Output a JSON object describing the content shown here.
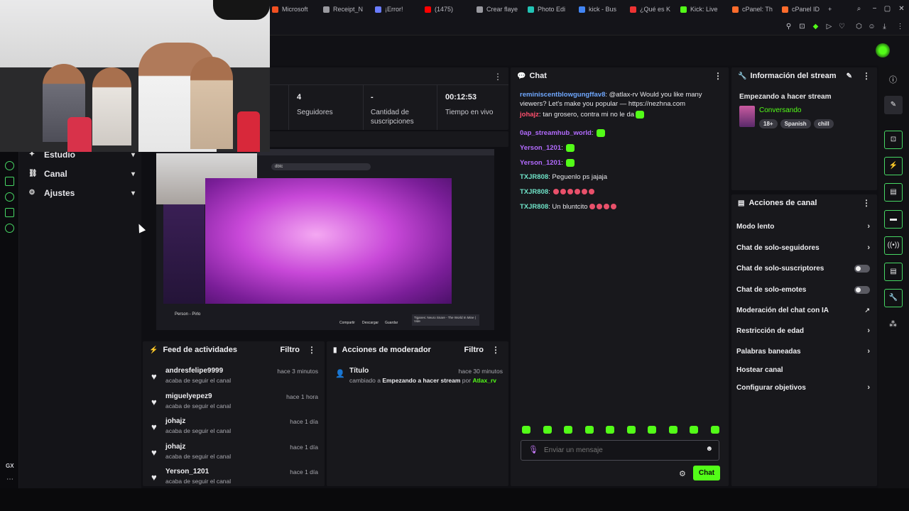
{
  "browser": {
    "tabs": [
      {
        "label": "Microsoft",
        "color": "#f25022"
      },
      {
        "label": "Receipt_N",
        "color": "#9a9aa0"
      },
      {
        "label": "¡Error!",
        "color": "#6a7cff"
      },
      {
        "label": "(1475)",
        "color": "#ff0000"
      },
      {
        "label": "Crear flaye",
        "color": "#9a9aa0"
      },
      {
        "label": "Photo Edi",
        "color": "#22c3b5"
      },
      {
        "label": "kick - Bus",
        "color": "#4285f4"
      },
      {
        "label": "¿Qué es K",
        "color": "#e33"
      },
      {
        "label": "Kick: Live",
        "color": "#53fc18"
      },
      {
        "label": "cPanel: Th",
        "color": "#ff6c2c"
      },
      {
        "label": "cPanel ID",
        "color": "#ff6c2c"
      }
    ]
  },
  "gx": {
    "label": "GX"
  },
  "nav": {
    "items": [
      {
        "label": "Estudio",
        "icon": "studio-icon"
      },
      {
        "label": "Canal",
        "icon": "channel-icon"
      },
      {
        "label": "Ajustes",
        "icon": "gear-icon"
      }
    ]
  },
  "stats": {
    "followers": {
      "value": "4",
      "label": "Seguidores"
    },
    "subs": {
      "value": "-",
      "label": "Cantidad de suscripciones"
    },
    "live_time": {
      "value": "00:12:53",
      "label": "Tiempo en vivo"
    }
  },
  "video": {
    "search_text": "dbtc",
    "title": "Person - Pirlo",
    "now_playing": "Tiganes: Neuro Snare - The World In Mine | Vide",
    "buttons": [
      "Compartir",
      "Descargar",
      "Guardar"
    ]
  },
  "feed": {
    "title": "Feed de actividades",
    "filter": "Filtro",
    "items": [
      {
        "name": "andresfelipe9999",
        "sub": "acaba de seguir el canal",
        "time": "hace 3 minutos"
      },
      {
        "name": "miguelyepez9",
        "sub": "acaba de seguir el canal",
        "time": "hace 1 hora"
      },
      {
        "name": "johajz",
        "sub": "acaba de seguir el canal",
        "time": "hace 1 día"
      },
      {
        "name": "johajz",
        "sub": "acaba de seguir el canal",
        "time": "hace 1 día"
      },
      {
        "name": "Yerson_1201",
        "sub": "acaba de seguir el canal",
        "time": "hace 1 día"
      }
    ]
  },
  "mod": {
    "title": "Acciones de moderador",
    "filter": "Filtro",
    "item": {
      "label": "Título",
      "time": "hace 30 minutos",
      "prefix": "cambiado a",
      "value": "Empezando a hacer stream",
      "by": "por",
      "user": "Atlax_rv"
    }
  },
  "chat": {
    "title": "Chat",
    "messages": [
      {
        "user": "reminiscentblowgungffav8",
        "color": "#6fa8ff",
        "text": "@atlax-rv Would you like many viewers? Let's make you popular — https://nezhna.com",
        "emotes": 0
      },
      {
        "user": "johajz",
        "color": "#ff4f6d",
        "text": "tan grosero, contra mi no le da",
        "emotes": 1
      },
      {
        "user": "0ap_streamhub_world",
        "color": "#b36bff",
        "text": "",
        "emotes": 1
      },
      {
        "user": "Yerson_1201",
        "color": "#b36bff",
        "text": "",
        "emotes": 1
      },
      {
        "user": "Yerson_1201",
        "color": "#b36bff",
        "text": "",
        "emotes": 1
      },
      {
        "user": "TXJR808",
        "color": "#6fe3c8",
        "text": "Peguenlo ps jajaja",
        "emotes": 0
      },
      {
        "user": "TXJR808",
        "color": "#6fe3c8",
        "text": "",
        "emotes": 6
      },
      {
        "user": "TXJR808",
        "color": "#6fe3c8",
        "text": "Un bluntcito",
        "emotes": 4
      }
    ],
    "placeholder": "Enviar un mensaje",
    "send": "Chat"
  },
  "info": {
    "title": "Información del stream",
    "stream_title": "Empezando a hacer stream",
    "category": "Conversando",
    "tags": [
      "18+",
      "Spanish",
      "chill"
    ]
  },
  "actions": {
    "title": "Acciones de canal",
    "items": [
      {
        "label": "Modo lento",
        "kind": "arrow"
      },
      {
        "label": "Chat de solo-seguidores",
        "kind": "arrow"
      },
      {
        "label": "Chat de solo-suscriptores",
        "kind": "toggle"
      },
      {
        "label": "Chat de solo-emotes",
        "kind": "toggle"
      },
      {
        "label": "Moderación del chat con IA",
        "kind": "external"
      },
      {
        "label": "Restricción de edad",
        "kind": "arrow"
      },
      {
        "label": "Palabras baneadas",
        "kind": "arrow"
      },
      {
        "label": "Hostear canal",
        "kind": "none"
      },
      {
        "label": "Configurar objetivos",
        "kind": "arrow"
      }
    ]
  },
  "colors": {
    "accent": "#53fc18",
    "panel": "#18181c",
    "bg": "#0f0f13"
  }
}
